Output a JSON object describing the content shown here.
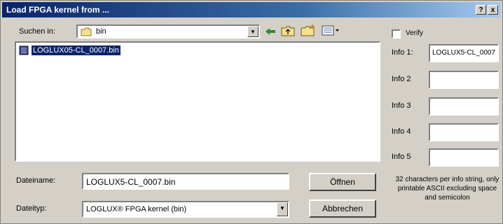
{
  "window": {
    "title": "Load FPGA kernel from ...",
    "help_label": "?",
    "close_label": "x"
  },
  "look_in": {
    "label": "Suchen in:",
    "value": "bin"
  },
  "file_list": [
    {
      "name": "LOGLUX05-CL_0007.bin",
      "selected": true
    }
  ],
  "filename": {
    "label": "Dateiname:",
    "value": "LOGLUX5-CL_0007.bin"
  },
  "filetype": {
    "label": "Dateityp:",
    "value": "LOGLUX® FPGA kernel (bin)"
  },
  "buttons": {
    "open": "Öffnen",
    "cancel": "Abbrechen"
  },
  "verify": {
    "label": "Verify",
    "checked": false
  },
  "info_fields": [
    {
      "label": "Info 1:",
      "value": "LOGLUX5-CL_0007"
    },
    {
      "label": "Info 2",
      "value": ""
    },
    {
      "label": "Info 3",
      "value": ""
    },
    {
      "label": "Info 4",
      "value": ""
    },
    {
      "label": "Info 5",
      "value": ""
    }
  ],
  "note": "32 characters per info string, only printable ASCII excluding space and semicolon",
  "toolbar_icons": [
    "back-arrow-icon",
    "up-folder-icon",
    "new-folder-icon",
    "view-menu-icon"
  ],
  "colors": {
    "title_start": "#0a246a",
    "title_end": "#a6caf0",
    "selection": "#0a246a",
    "face": "#d4d0c8"
  }
}
